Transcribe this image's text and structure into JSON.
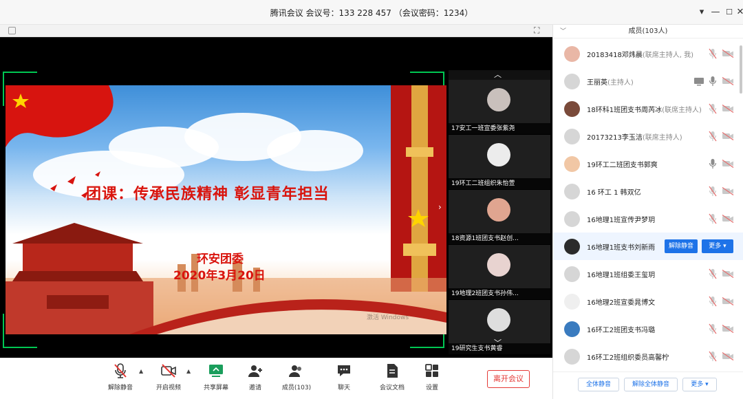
{
  "window": {
    "title": "腾讯会议  会议号：133 228 457  （会议密码：1234）"
  },
  "slide": {
    "title": "团课：传承民族精神     彰显青年担当",
    "org": "环安团委",
    "date": "2020年3月20日",
    "watermark": "激活 Windows"
  },
  "strip": {
    "participants": [
      {
        "label": "17安工一班宣委张紫尧"
      },
      {
        "label": "19环工二班组织朱怡萱"
      },
      {
        "label": "18资源1班团支书赵创..."
      },
      {
        "label": "19地理2班团支书孙伟..."
      },
      {
        "label": "19研究生支书黄睿"
      }
    ]
  },
  "toolbar": {
    "unmute": "解除静音",
    "video": "开启视频",
    "share": "共享屏幕",
    "invite": "邀请",
    "members": "成员(103)",
    "chat": "聊天",
    "docs": "会议文档",
    "settings": "设置",
    "leave": "离开会议"
  },
  "panel": {
    "title": "成员(103人)",
    "members": [
      {
        "name": "20183418邓炜晨",
        "role": "(联席主持人, 我)",
        "avatar_color": "#e9b7a6"
      },
      {
        "name": "王丽英",
        "role": "(主持人)",
        "avatar_color": "#d6d6d6"
      },
      {
        "name": "18环科1班团支书周芮冰",
        "role": "(联席主持人)",
        "avatar_color": "#7a4a3a"
      },
      {
        "name": "20173213李玉洁",
        "role": "(联席主持人)",
        "avatar_color": "#d6d6d6"
      },
      {
        "name": "19环工二班团支书郭爽",
        "role": "",
        "avatar_color": "#f1c7a5"
      },
      {
        "name": "16 环工 1 韩双亿",
        "role": "",
        "avatar_color": "#d6d6d6"
      },
      {
        "name": "16地理1班宣传尹梦玥",
        "role": "",
        "avatar_color": "#d6d6d6"
      },
      {
        "name": "16地理1班支书刘新雨",
        "role": "",
        "avatar_color": "#2b2b2b"
      },
      {
        "name": "16地理1班组委王玺玥",
        "role": "",
        "avatar_color": "#d6d6d6"
      },
      {
        "name": "16地理2班宣委晁博文",
        "role": "",
        "avatar_color": "#efefef"
      },
      {
        "name": "16环工2班团支书冯璐",
        "role": "",
        "avatar_color": "#3a7bbf"
      },
      {
        "name": "16环工2班组织委员高馨柠",
        "role": "",
        "avatar_color": "#d6d6d6"
      }
    ],
    "highlight_buttons": {
      "unmute": "解除静音",
      "more": "更多 ▾"
    },
    "footer": {
      "mute_all": "全体静音",
      "unmute_all": "解除全体静音",
      "more": "更多 ▾"
    }
  },
  "colors": {
    "accent": "#1e73e8",
    "danger": "#e53935",
    "corner": "#00c853",
    "slide_red": "#d9140d"
  }
}
